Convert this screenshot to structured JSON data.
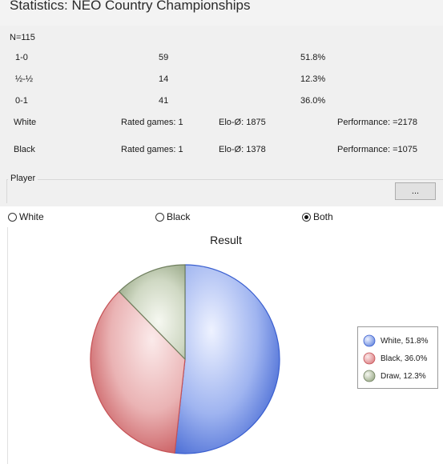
{
  "window": {
    "title": "Statistics: NEO Country Championships"
  },
  "summary": {
    "n_label": "N=115"
  },
  "results": [
    {
      "label": "1-0",
      "count": "59",
      "percent": "51.8%"
    },
    {
      "label": "½-½",
      "count": "14",
      "percent": "12.3%"
    },
    {
      "label": "0-1",
      "count": "41",
      "percent": "36.0%"
    }
  ],
  "players": [
    {
      "color": "White",
      "rated": "Rated games: 1",
      "elo": "Elo-Ø: 1875",
      "performance": "Performance: =2178"
    },
    {
      "color": "Black",
      "rated": "Rated games: 1",
      "elo": "Elo-Ø: 1378",
      "performance": "Performance: =1075"
    }
  ],
  "player_group": {
    "legend": "Player",
    "browse_label": "..."
  },
  "color_filter": {
    "options": [
      {
        "label": "White",
        "checked": false
      },
      {
        "label": "Black",
        "checked": false
      },
      {
        "label": "Both",
        "checked": true
      }
    ]
  },
  "chart_data": {
    "type": "pie",
    "title": "Result",
    "series": [
      {
        "name": "White, 51.8%",
        "value": 51.8,
        "color": "#5b7fdb"
      },
      {
        "name": "Black, 36.0%",
        "value": 36.0,
        "color": "#d9767a"
      },
      {
        "name": "Draw, 12.3%",
        "value": 12.3,
        "color": "#a7b596"
      }
    ],
    "legend_position": "right"
  }
}
